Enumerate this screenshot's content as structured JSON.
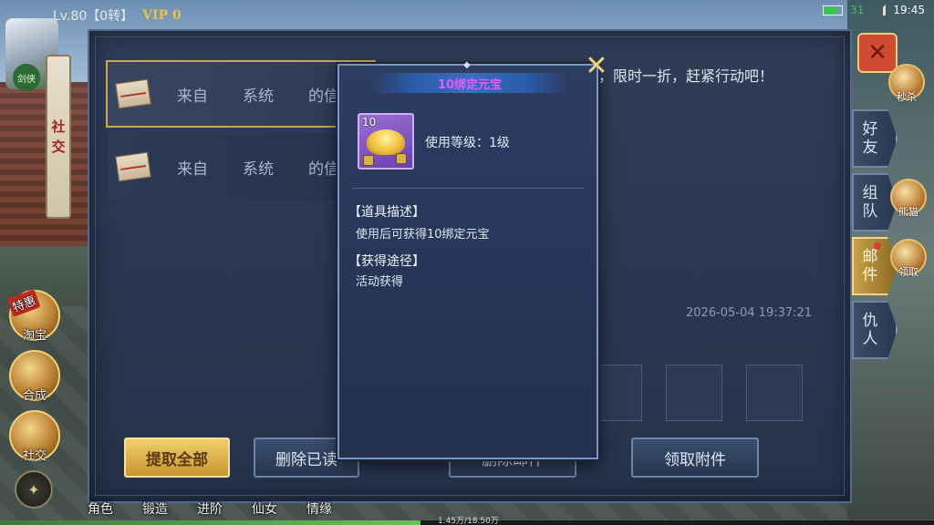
{
  "status": {
    "battery_level": "31",
    "time": "19:45"
  },
  "player": {
    "level_text": "Lv.80【0转】",
    "vip": "VIP 0"
  },
  "left": {
    "avatar_label": "剑侠",
    "social_scroll": [
      "社",
      "交"
    ],
    "hot_tag": "特惠",
    "buttons": [
      {
        "label": "淘宝",
        "icon": "treasure-icon"
      },
      {
        "label": "合成",
        "icon": "craft-icon"
      },
      {
        "label": "社交",
        "icon": "fist-icon"
      }
    ]
  },
  "bottom_nav": [
    "角色",
    "锻造",
    "进阶",
    "仙女",
    "情缘"
  ],
  "exp_text": "1.45万/18.50万",
  "right_tabs": [
    {
      "label": [
        "好",
        "友"
      ],
      "active": false,
      "dot": false
    },
    {
      "label": [
        "组",
        "队"
      ],
      "active": false,
      "dot": false
    },
    {
      "label": [
        "邮",
        "件"
      ],
      "active": true,
      "dot": true
    },
    {
      "label": [
        "仇",
        "人"
      ],
      "active": false,
      "dot": false
    }
  ],
  "right_icons": [
    "秒杀",
    "熊猫",
    "领取"
  ],
  "mail": {
    "items": [
      {
        "from": [
          "来自",
          "系统",
          "的信"
        ],
        "selected": true
      },
      {
        "from": [
          "来自",
          "系统",
          "的信"
        ],
        "selected": false
      }
    ],
    "content": "亲爱的玩家，特惠特惠已经开启，限时一折，赶紧行动吧！",
    "date": "2026-05-04   19:37:21",
    "attachment_count": "10",
    "buttons": {
      "take_all": "提取全部",
      "delete_read": "删除已读",
      "delete_mail": "删除邮件",
      "take_attachment": "领取附件"
    }
  },
  "popup": {
    "title": "10绑定元宝",
    "item_count": "10",
    "use_level": "使用等级：1级",
    "desc_head": "【道具描述】",
    "desc_text": "使用后可获得10绑定元宝",
    "source_head": "【获得途径】",
    "source_text": "活动获得",
    "title_color": "#e45aff"
  },
  "colors": {
    "accent_gold": "#c9a94d",
    "panel_bg": "#2f3d58",
    "battery_green": "#2ecc40"
  }
}
